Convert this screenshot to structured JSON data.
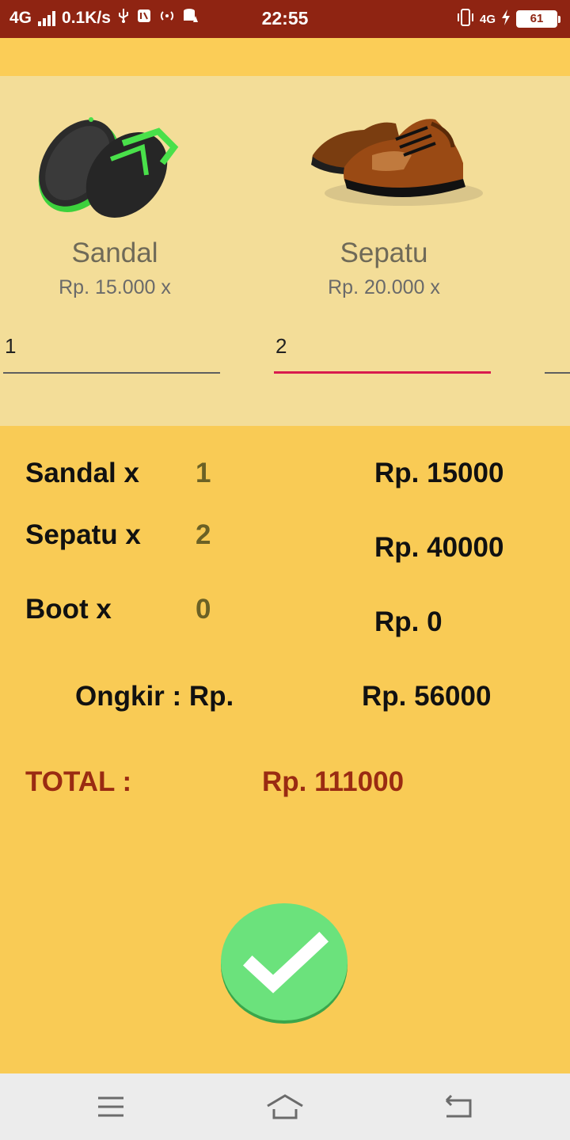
{
  "status": {
    "network_left": "4G",
    "speed": "0.1K/s",
    "time": "22:55",
    "network_right": "4G",
    "battery": "61"
  },
  "products": [
    {
      "name": "Sandal",
      "price": "Rp. 15.000  x",
      "qty": "1",
      "image": "sandal-image"
    },
    {
      "name": "Sepatu",
      "price": "Rp. 20.000  x",
      "qty": "2",
      "image": "shoe-image"
    }
  ],
  "summary": {
    "rows": [
      {
        "label": "Sandal x",
        "qty": "1",
        "amount": "Rp. 15000"
      },
      {
        "label": "Sepatu x",
        "qty": "2",
        "amount": "Rp. 40000"
      },
      {
        "label": "Boot x",
        "qty": "0",
        "amount": "Rp. 0"
      }
    ],
    "ongkir_label": "Ongkir : Rp.",
    "ongkir_value": "Rp. 56000",
    "total_label": "TOTAL :",
    "total_value": "Rp. 111000"
  },
  "colors": {
    "status_bar": "#8f2412",
    "background": "#f9cb55",
    "products_bg": "#f3dd98",
    "accent_underline": "#d81b4e",
    "confirm_button": "#6be27c",
    "total_text": "#9a2b12"
  },
  "icons": {
    "confirm": "check-icon",
    "nav_menu": "menu-icon",
    "nav_home": "home-icon",
    "nav_back": "back-icon"
  }
}
